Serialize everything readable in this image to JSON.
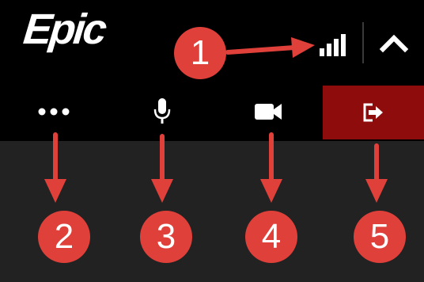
{
  "app": {
    "logo_text": "Epic"
  },
  "toolbar": {
    "signal_icon": "signal-strength-icon",
    "collapse_icon": "chevron-up-icon",
    "controls": [
      {
        "name": "more-options",
        "icon": "ellipsis-icon"
      },
      {
        "name": "microphone",
        "icon": "microphone-icon"
      },
      {
        "name": "video",
        "icon": "video-camera-icon"
      },
      {
        "name": "leave-call",
        "icon": "exit-icon"
      }
    ]
  },
  "annotations": {
    "badges": [
      "1",
      "2",
      "3",
      "4",
      "5"
    ]
  },
  "colors": {
    "toolbar_bg": "#000000",
    "panel_bg": "#222222",
    "exit_bg": "#8e0c0c",
    "annotation_red": "#e0403a",
    "icon": "#ffffff"
  }
}
